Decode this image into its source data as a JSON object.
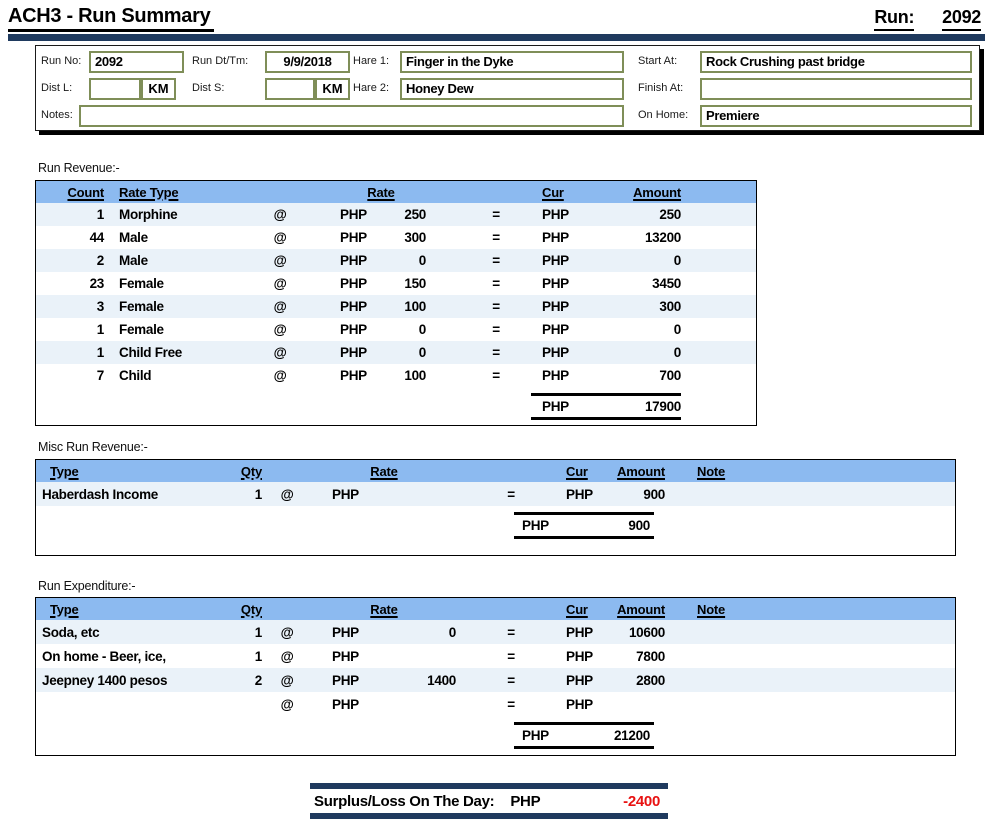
{
  "header": {
    "title": "ACH3 - Run Summary",
    "run_label": "Run:",
    "run_number": "2092"
  },
  "run_details": {
    "run_no_label": "Run No:",
    "run_no": "2092",
    "run_dt_label": "Run Dt/Tm:",
    "run_dt": "9/9/2018",
    "hare1_label": "Hare 1:",
    "hare1": "Finger in the Dyke",
    "start_at_label": "Start At:",
    "start_at": "Rock Crushing past bridge",
    "dist_l_label": "Dist L:",
    "dist_l": "",
    "km_label": "KM",
    "dist_s_label": "Dist S:",
    "dist_s": "",
    "hare2_label": "Hare 2:",
    "hare2": "Honey Dew",
    "finish_at_label": "Finish At:",
    "finish_at": "",
    "notes_label": "Notes:",
    "notes": "",
    "on_home_label": "On Home:",
    "on_home": "Premiere"
  },
  "run_revenue": {
    "section_label": "Run Revenue:-",
    "headers": {
      "count": "Count",
      "rate_type": "Rate Type",
      "rate": "Rate",
      "cur": "Cur",
      "amount": "Amount"
    },
    "rows": [
      {
        "count": "1",
        "rate_type": "Morphine",
        "at": "@",
        "rate_cur": "PHP",
        "rate": "250",
        "eq": "=",
        "cur": "PHP",
        "amount": "250"
      },
      {
        "count": "44",
        "rate_type": "Male",
        "at": "@",
        "rate_cur": "PHP",
        "rate": "300",
        "eq": "=",
        "cur": "PHP",
        "amount": "13200"
      },
      {
        "count": "2",
        "rate_type": "Male",
        "at": "@",
        "rate_cur": "PHP",
        "rate": "0",
        "eq": "=",
        "cur": "PHP",
        "amount": "0"
      },
      {
        "count": "23",
        "rate_type": "Female",
        "at": "@",
        "rate_cur": "PHP",
        "rate": "150",
        "eq": "=",
        "cur": "PHP",
        "amount": "3450"
      },
      {
        "count": "3",
        "rate_type": "Female",
        "at": "@",
        "rate_cur": "PHP",
        "rate": "100",
        "eq": "=",
        "cur": "PHP",
        "amount": "300"
      },
      {
        "count": "1",
        "rate_type": "Female",
        "at": "@",
        "rate_cur": "PHP",
        "rate": "0",
        "eq": "=",
        "cur": "PHP",
        "amount": "0"
      },
      {
        "count": "1",
        "rate_type": "Child Free",
        "at": "@",
        "rate_cur": "PHP",
        "rate": "0",
        "eq": "=",
        "cur": "PHP",
        "amount": "0"
      },
      {
        "count": "7",
        "rate_type": "Child",
        "at": "@",
        "rate_cur": "PHP",
        "rate": "100",
        "eq": "=",
        "cur": "PHP",
        "amount": "700"
      }
    ],
    "total": {
      "cur": "PHP",
      "amount": "17900"
    }
  },
  "misc_revenue": {
    "section_label": "Misc Run Revenue:-",
    "headers": {
      "type": "Type",
      "qty": "Qty",
      "rate": "Rate",
      "cur": "Cur",
      "amount": "Amount",
      "note": "Note"
    },
    "rows": [
      {
        "type": "Haberdash Income",
        "qty": "1",
        "at": "@",
        "rate_cur": "PHP",
        "rate": "",
        "eq": "=",
        "cur": "PHP",
        "amount": "900",
        "note": ""
      }
    ],
    "total": {
      "cur": "PHP",
      "amount": "900"
    }
  },
  "run_expenditure": {
    "section_label": "Run Expenditure:-",
    "headers": {
      "type": "Type",
      "qty": "Qty",
      "rate": "Rate",
      "cur": "Cur",
      "amount": "Amount",
      "note": "Note"
    },
    "rows": [
      {
        "type": "Soda, etc",
        "qty": "1",
        "at": "@",
        "rate_cur": "PHP",
        "rate": "0",
        "eq": "=",
        "cur": "PHP",
        "amount": "10600",
        "note": ""
      },
      {
        "type": "On home - Beer, ice,",
        "qty": "1",
        "at": "@",
        "rate_cur": "PHP",
        "rate": "",
        "eq": "=",
        "cur": "PHP",
        "amount": "7800",
        "note": ""
      },
      {
        "type": "Jeepney 1400 pesos",
        "qty": "2",
        "at": "@",
        "rate_cur": "PHP",
        "rate": "1400",
        "eq": "=",
        "cur": "PHP",
        "amount": "2800",
        "note": ""
      },
      {
        "type": "",
        "qty": "",
        "at": "@",
        "rate_cur": "PHP",
        "rate": "",
        "eq": "=",
        "cur": "PHP",
        "amount": "",
        "note": ""
      }
    ],
    "total": {
      "cur": "PHP",
      "amount": "21200"
    }
  },
  "surplus": {
    "label": "Surplus/Loss On The Day:",
    "cur": "PHP",
    "amount": "-2400"
  },
  "colors": {
    "navy_bar": "#1f3a5e",
    "table_header_blue": "#8cbaf0",
    "row_stripe": "#eaf2f9",
    "field_border": "#7f8e58",
    "negative_red": "#e81212"
  }
}
